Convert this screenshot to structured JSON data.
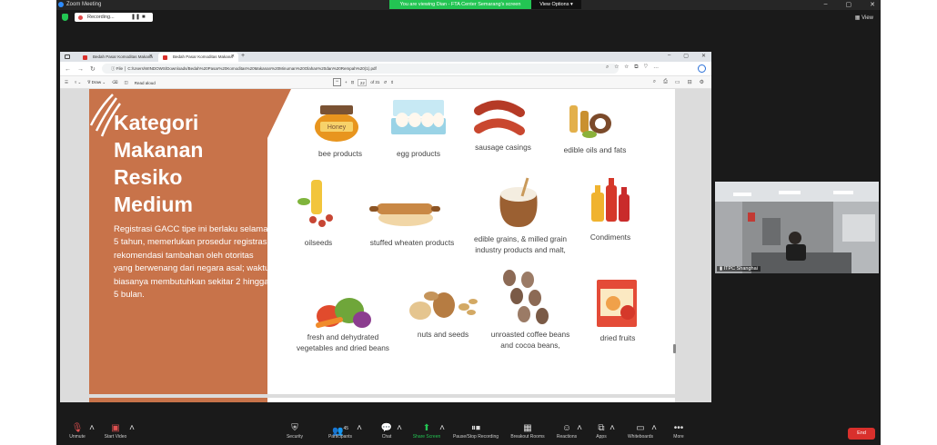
{
  "zoom": {
    "title": "Zoom Meeting",
    "banner": "You are viewing Dian - FTA Center Semarang's screen",
    "view_options": "View Options",
    "recording": "Recording...",
    "view": "View"
  },
  "browser": {
    "tab1": "Bedah Pasar Komoditas Makana",
    "tab2": "Bedah Pasar Komoditas Makana",
    "url": "C:/Users/WINDOWS/Downloads/Bedah%20Pasar%20Komoditas%20Makanan%20Minuman%20Olahan%20dan%20Rempah%20(1).pdf",
    "file_label": "File",
    "draw": "Draw",
    "read_aloud": "Read aloud",
    "page_current": "22",
    "page_total": "of 31"
  },
  "slide": {
    "title_lines": [
      "Kategori",
      "Makanan",
      "Resiko",
      "Medium"
    ],
    "body": "Registrasi GACC tipe ini berlaku selama 5 tahun, memerlukan prosedur registrasi rekomendasi tambahan oleh otoritas yang berwenang dari negara asal; waktu biasanya membutuhkan sekitar 2 hingga 5 bulan.",
    "items": {
      "bee": "bee products",
      "egg": "egg products",
      "sausage": "sausage casings",
      "oils": "edible oils and fats",
      "oilseeds": "oilseeds",
      "stuffed": "stuffed wheaten products",
      "grains1": "edible grains, & milled grain",
      "grains2": "industry products and malt,",
      "condiments": "Condiments",
      "veg1": "fresh and dehydrated",
      "veg2": "vegetables and dried beans",
      "nuts": "nuts and seeds",
      "coffee1": "unroasted coffee beans",
      "coffee2": "and cocoa beans,",
      "fruits": "dried fruits",
      "honey": "Honey"
    }
  },
  "video": {
    "name": "ITPC Shanghai"
  },
  "toolbar": {
    "unmute": "Unmute",
    "start_video": "Start Video",
    "security": "Security",
    "participants": "Participants",
    "participants_count": "45",
    "chat": "Chat",
    "share": "Share Screen",
    "record": "Pause/Stop Recording",
    "breakout": "Breakout Rooms",
    "reactions": "Reactions",
    "apps": "Apps",
    "whiteboards": "Whiteboards",
    "more": "More",
    "end": "End"
  }
}
